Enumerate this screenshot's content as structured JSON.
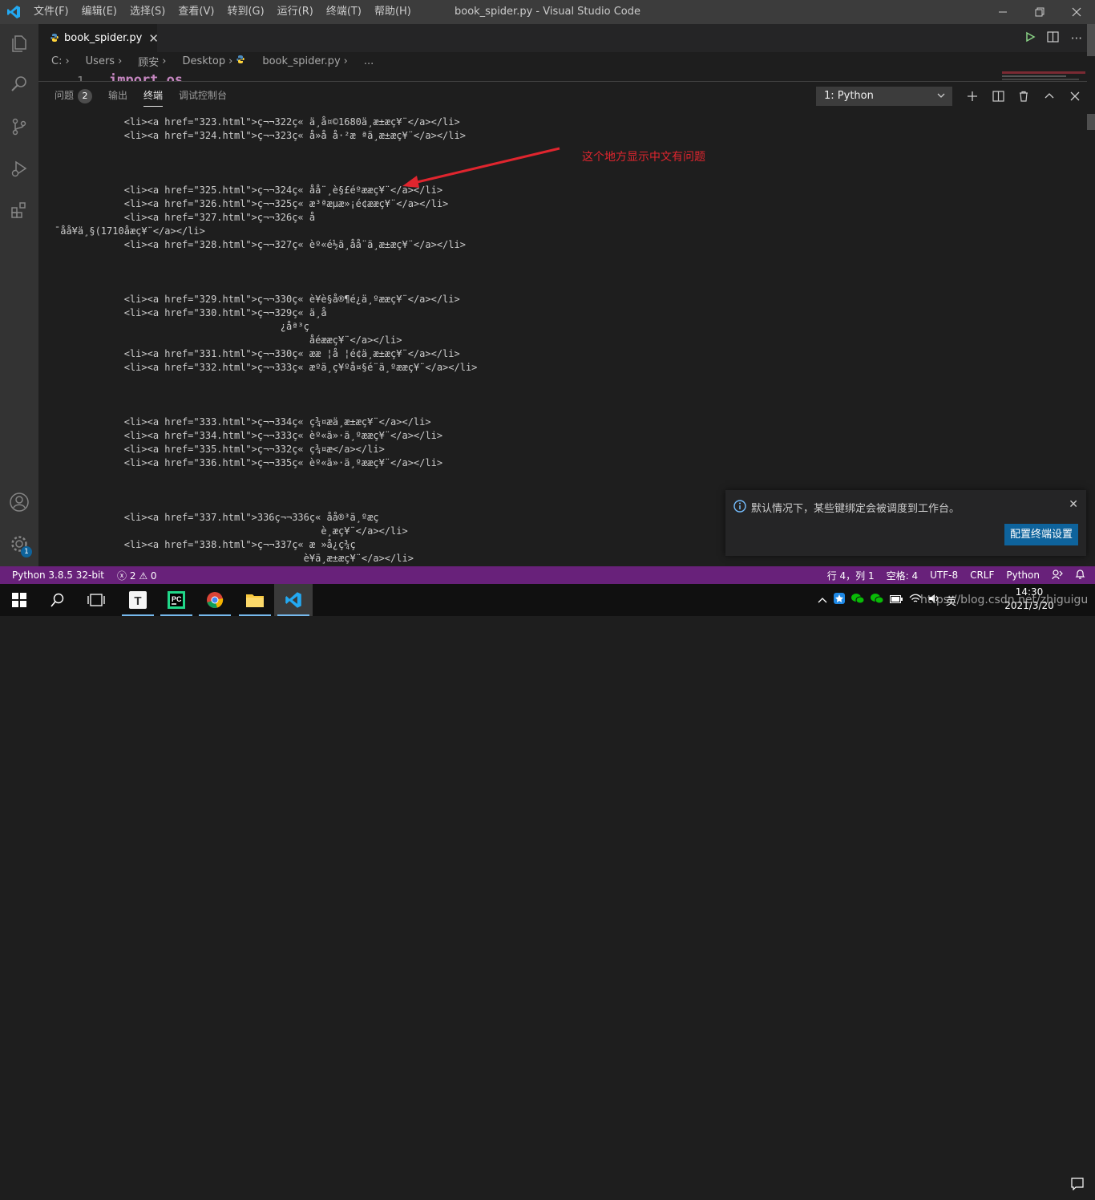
{
  "window": {
    "title": "book_spider.py - Visual Studio Code",
    "menu": [
      "文件(F)",
      "编辑(E)",
      "选择(S)",
      "查看(V)",
      "转到(G)",
      "运行(R)",
      "终端(T)",
      "帮助(H)"
    ]
  },
  "activity_bar": {
    "icons": [
      "explorer-icon",
      "search-icon",
      "source-control-icon",
      "run-debug-icon",
      "extensions-icon",
      "account-icon",
      "settings-gear-icon"
    ],
    "settings_badge": "1"
  },
  "editor": {
    "tab_label": "book_spider.py",
    "breadcrumb": [
      "C:",
      "Users",
      "顾安",
      "Desktop",
      "book_spider.py",
      "..."
    ],
    "peek_line_number": "1",
    "peek_code": "import os"
  },
  "panel": {
    "tabs": [
      {
        "label": "问题",
        "badge": "2",
        "active": false
      },
      {
        "label": "输出",
        "active": false
      },
      {
        "label": "终端",
        "active": true
      },
      {
        "label": "调试控制台",
        "active": false
      }
    ],
    "terminal_select": "1: Python",
    "terminal_lines": [
      "            <li><a href=\"323.html\">ç¬¬322ç« ä¸å¤©1680ä¸æ±æç¥¨</a></li>",
      "            <li><a href=\"324.html\">ç¬¬323ç« å»å å·²æ ªä¸æ±æç¥¨</a></li>",
      "",
      "",
      "",
      "            <li><a href=\"325.html\">ç¬¬324ç« åå¨¸è§£éºææç¥¨</a></li>",
      "            <li><a href=\"326.html\">ç¬¬325ç« æ³ªæµæ»¡é¢ææç¥¨</a></li>",
      "            <li><a href=\"327.html\">ç¬¬326ç« å",
      "¯åå¥ä¸§(1710åæç¥¨</a></li>",
      "            <li><a href=\"328.html\">ç¬¬327ç« èº«é½ä¸åå¨ä¸æ±æç¥¨</a></li>",
      "",
      "",
      "",
      "            <li><a href=\"329.html\">ç¬¬330ç« è¥è§å®¶é¿ä¸ºææç¥¨</a></li>",
      "            <li><a href=\"330.html\">ç¬¬329ç« ä¸å",
      "                                       ¿åª³ç",
      "                                            åéææç¥¨</a></li>",
      "            <li><a href=\"331.html\">ç¬¬330ç« ææ ¦å ¦é¢ä¸æ±æç¥¨</a></li>",
      "            <li><a href=\"332.html\">ç¬¬333ç« æºä¸ç¥ºå¤§é¨ä¸ºææç¥¨</a></li>",
      "",
      "",
      "",
      "            <li><a href=\"333.html\">ç¬¬334ç« ç¾¤æä¸æ±æç¥¨</a></li>",
      "            <li><a href=\"334.html\">ç¬¬333ç« èº«ä»·ä¸ºææç¥¨</a></li>",
      "            <li><a href=\"335.html\">ç¬¬332ç« ç¾¤æ</a></li>",
      "            <li><a href=\"336.html\">ç¬¬335ç« èº«ä»·ä¸ºææç¥¨</a></li>",
      "",
      "",
      "",
      "            <li><a href=\"337.html\">336ç¬¬336ç« åå®³ä¸ºæç",
      "                                              è¸æç¥¨</a></li>",
      "            <li><a href=\"338.html\">ç¬¬337ç« æ »å¿ç¾ç",
      "                                           è¥ä¸æ±æç¥¨</a></li>"
    ]
  },
  "annotation": {
    "text": "这个地方显示中文有问题",
    "color": "#e0252e"
  },
  "notification": {
    "message": "默认情况下，某些键绑定会被调度到工作台。",
    "button": "配置终端设置"
  },
  "status_bar": {
    "python": "Python 3.8.5 32-bit",
    "errors": "2",
    "warnings": "0",
    "position": "行 4，列 1",
    "spaces": "空格: 4",
    "encoding": "UTF-8",
    "eol": "CRLF",
    "language": "Python"
  },
  "taskbar": {
    "apps": [
      "start-icon",
      "search-icon",
      "task-view-icon",
      "typora-icon",
      "pycharm-icon",
      "chrome-icon",
      "file-explorer-icon",
      "vscode-icon"
    ],
    "ime": "英",
    "time": "14:30",
    "date": "2021/3/20"
  },
  "watermark": "https://blog.csdn.net/zhiguigu",
  "colors": {
    "accent": "#0e639c",
    "statusbar": "#68217a",
    "titlebar": "#3c3c3c",
    "vscode_blue": "#23a9f2"
  }
}
